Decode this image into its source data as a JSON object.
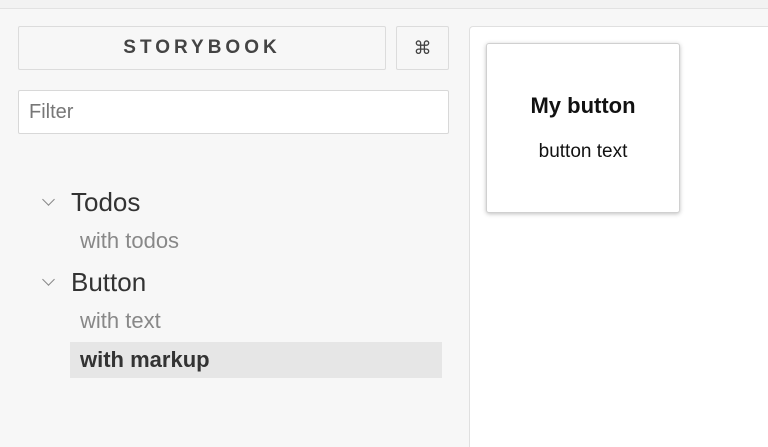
{
  "sidebar": {
    "brand_label": "STORYBOOK",
    "shortcut_icon": "command-icon",
    "shortcut_glyph": "⌘",
    "filter_placeholder": "Filter",
    "filter_value": "",
    "kinds": [
      {
        "name": "Todos",
        "expanded": true,
        "stories": [
          {
            "label": "with todos",
            "selected": false
          }
        ]
      },
      {
        "name": "Button",
        "expanded": true,
        "stories": [
          {
            "label": "with text",
            "selected": false
          },
          {
            "label": "with markup",
            "selected": true
          }
        ]
      }
    ]
  },
  "preview": {
    "title": "My button",
    "text": "button text"
  },
  "colors": {
    "selected_bg": "#e6e6e6",
    "sidebar_bg": "#f7f7f7",
    "preview_bg": "#ffffff"
  }
}
